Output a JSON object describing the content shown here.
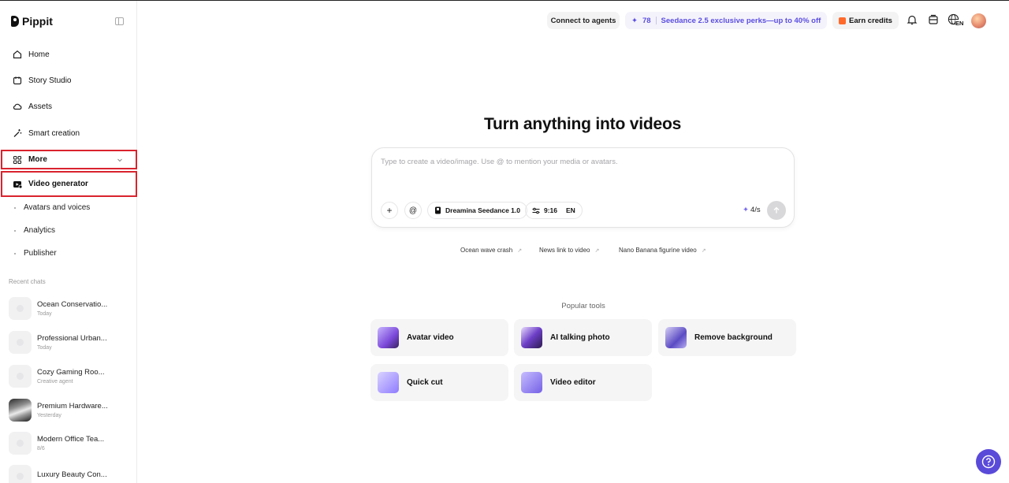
{
  "app": {
    "name": "Pippit"
  },
  "sidebar": {
    "items": [
      {
        "label": "Home",
        "icon": "home-icon"
      },
      {
        "label": "Story Studio",
        "icon": "story-icon"
      },
      {
        "label": "Assets",
        "icon": "cloud-icon"
      },
      {
        "label": "Smart creation",
        "icon": "magic-wand-icon"
      }
    ],
    "more_label": "More",
    "active_label": "Video generator",
    "sub_items": [
      "Avatars and voices",
      "Analytics",
      "Publisher"
    ],
    "recent_title": "Recent chats",
    "recent_chats": [
      {
        "title": "Ocean Conservatio...",
        "sub": "Today"
      },
      {
        "title": "Professional Urban...",
        "sub": "Today"
      },
      {
        "title": "Cozy Gaming Roo...",
        "sub": "Creative agent"
      },
      {
        "title": "Premium Hardware...",
        "sub": "Yesterday"
      },
      {
        "title": "Modern Office Tea...",
        "sub": "8/6"
      },
      {
        "title": "Luxury Beauty Con...",
        "sub": ""
      }
    ]
  },
  "header": {
    "agents_label": "Connect to agents",
    "credits_count": "78",
    "promo_text": "Seedance 2.5 exclusive perks—up to 40% off",
    "earn_label": "Earn credits",
    "lang": "EN"
  },
  "main": {
    "title": "Turn anything into videos",
    "prompt_placeholder": "Type to create a video/image. Use @ to mention your media or avatars.",
    "model_label": "Dreamina Seedance 1.0",
    "ratio_label": "9:16",
    "lang_label": "EN",
    "credit_rate": "4/s",
    "suggestions": [
      "Ocean wave crash",
      "News link to video",
      "Nano Banana figurine video"
    ],
    "popular_title": "Popular tools",
    "tools": [
      "Avatar video",
      "AI talking photo",
      "Remove background",
      "Quick cut",
      "Video editor"
    ]
  },
  "colors": {
    "accent": "#5b4ee0",
    "highlight_border": "#d9232e",
    "help_button": "#5a4ad9"
  }
}
